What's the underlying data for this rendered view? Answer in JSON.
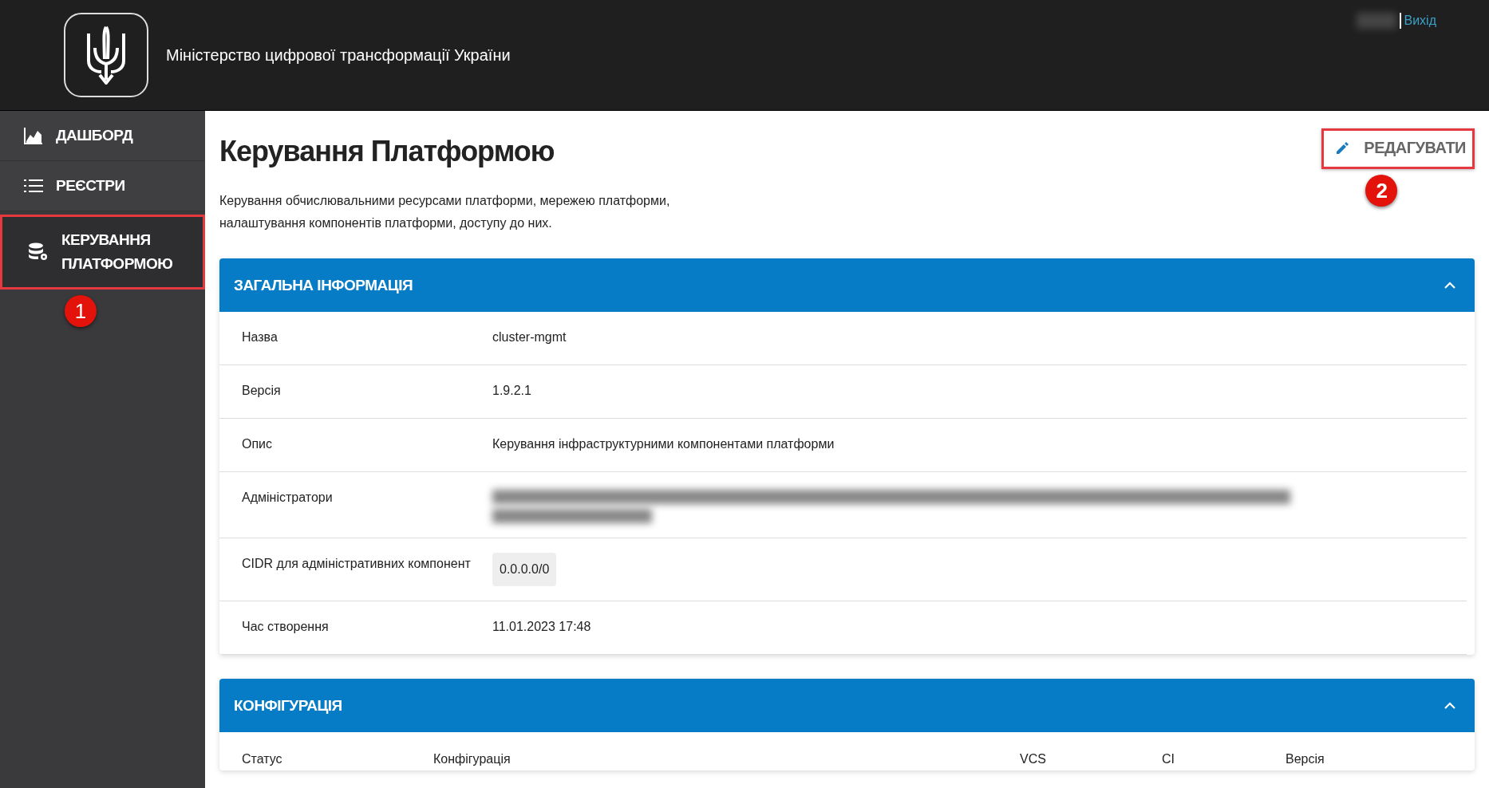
{
  "header": {
    "title": "Міністерство цифрової трансформації України",
    "logout": "Вихід"
  },
  "sidebar": {
    "items": [
      {
        "label": "ДАШБОРД",
        "kind": "chart",
        "selected": false,
        "highlighted": false
      },
      {
        "label": "РЕЄСТРИ",
        "kind": "list",
        "selected": false,
        "highlighted": false
      },
      {
        "label": "КЕРУВАННЯ ПЛАТФОРМОЮ",
        "kind": "database",
        "selected": true,
        "highlighted": true,
        "badge": "1"
      }
    ]
  },
  "page": {
    "title": "Керування Платформою",
    "description": "Керування обчислювальними ресурсами платформи, мережею платформи, налаштування компонентів платформи, доступу до них.",
    "edit_button": {
      "label": "РЕДАГУВАТИ",
      "highlighted": true,
      "badge": "2"
    }
  },
  "general_info": {
    "title": "ЗАГАЛЬНА ІНФОРМАЦІЯ",
    "expanded": true,
    "rows": [
      {
        "label": "Назва",
        "kind": "text",
        "value": "cluster-mgmt"
      },
      {
        "label": "Версія",
        "kind": "text",
        "value": "1.9.2.1"
      },
      {
        "label": "Опис",
        "kind": "text",
        "value": "Керування інфраструктурними компонентами платформи"
      },
      {
        "label": "Адміністратори",
        "kind": "redacted"
      },
      {
        "label": "CIDR для адміністративних компонент",
        "kind": "chip",
        "value": "0.0.0.0/0"
      },
      {
        "label": "Час створення",
        "kind": "text",
        "value": "11.01.2023 17:48"
      }
    ]
  },
  "configuration": {
    "title": "КОНФІГУРАЦІЯ",
    "expanded": true,
    "columns": [
      "Статус",
      "Конфігурація",
      "VCS",
      "CI",
      "Версія"
    ]
  }
}
